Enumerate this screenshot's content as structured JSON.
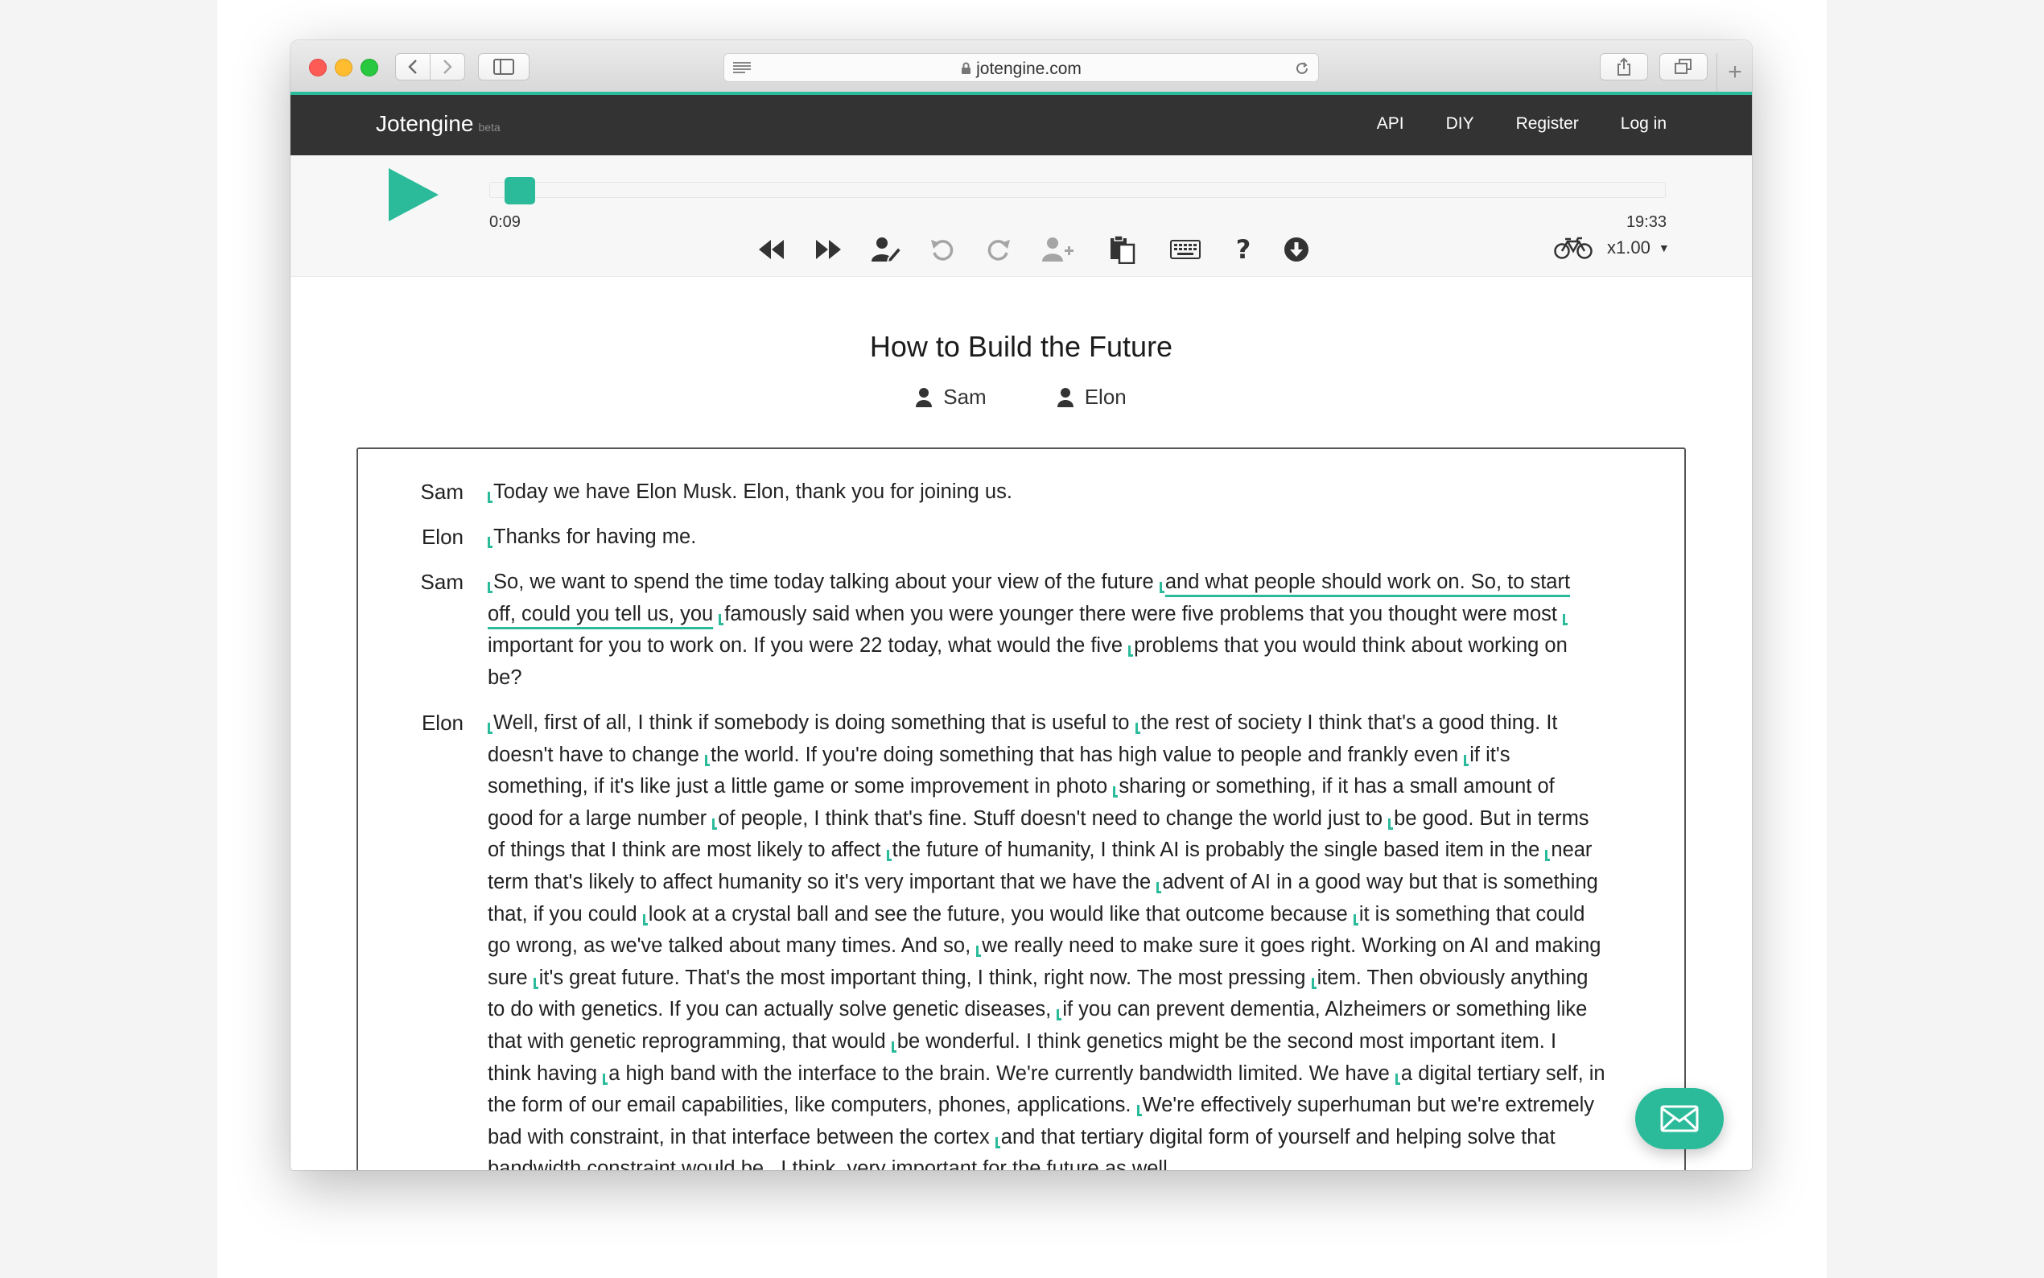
{
  "browser": {
    "url": "jotengine.com"
  },
  "site": {
    "brand": "Jotengine",
    "badge": "beta",
    "nav": [
      "API",
      "DIY",
      "Register",
      "Log in"
    ]
  },
  "player": {
    "current_time": "0:09",
    "total_time": "19:33",
    "progress": 0.008,
    "speed": "x1.00",
    "icons": [
      "rewind-icon",
      "fast-forward-icon",
      "edit-speakers-icon",
      "undo-icon",
      "redo-icon",
      "add-speaker-icon",
      "paste-icon",
      "keyboard-icon",
      "help-icon",
      "download-icon",
      "bicycle-icon"
    ]
  },
  "document": {
    "title": "How to Build the Future",
    "speakers": [
      "Sam",
      "Elon"
    ]
  },
  "transcript": [
    {
      "speaker": "Sam",
      "lines": [
        "Today we have Elon Musk. Elon, thank you for joining us."
      ]
    },
    {
      "speaker": "Elon",
      "lines": [
        "Thanks for having me."
      ]
    },
    {
      "speaker": "Sam",
      "lines": [
        "So, we want to spend the time today talking about your view of the future",
        "and what people should work on. So, to start",
        "off, could you tell us, you",
        "famously said when you were younger there were five problems that you thought were most",
        "important for you to work on. If you were 22 today, what would the five",
        "problems that you would think about working on",
        "be?"
      ]
    },
    {
      "speaker": "Elon",
      "lines": [
        "Well, first of all, I think if somebody is doing something that is useful to",
        "the rest of society I think that's a good thing. It",
        "doesn't have to change",
        "the world. If you're doing something that has high value to people and frankly even",
        "if it's",
        "something, if it's like just a little game or some improvement in photo",
        "sharing or something, if it has a small amount of",
        "good for a large number",
        "of people, I think that's fine. Stuff doesn't need to change the world just to",
        "be good. But in terms",
        "of things that I think are most likely to affect",
        "the future of humanity, I think AI is probably the single based item in the",
        "near",
        "term that's likely to affect humanity so it's very important that we have the",
        "advent of AI in a good way but that is something",
        "that, if you could",
        "look at a crystal ball and see the future, you would like that outcome because",
        "it is something that could",
        "go wrong, as we've talked about many times. And so,",
        "we really need to make sure it goes right. Working on AI and making",
        "sure",
        "it's great future. That's the most important thing, I think, right now. The most pressing",
        "item. Then obviously anything",
        "to do with genetics. If you can actually solve genetic diseases,",
        "if you can prevent dementia, Alzheimers or something like",
        "that with genetic reprogramming, that would",
        "be wonderful. I think genetics might be the second most important item. I",
        "think having",
        "a high band with the interface to the brain. We're currently bandwidth limited. We have",
        "a digital tertiary self, in",
        "the form of our email capabilities, like computers, phones, applications.",
        "We're effectively superhuman but we're extremely",
        "bad with constraint, in that interface between the cortex",
        "and that tertiary digital form of yourself and helping solve that",
        "bandwidth constraint would be , I think, very important for the future as well."
      ]
    }
  ],
  "colors": {
    "accent": "#2bbb9a",
    "nav_bg": "#333333"
  }
}
